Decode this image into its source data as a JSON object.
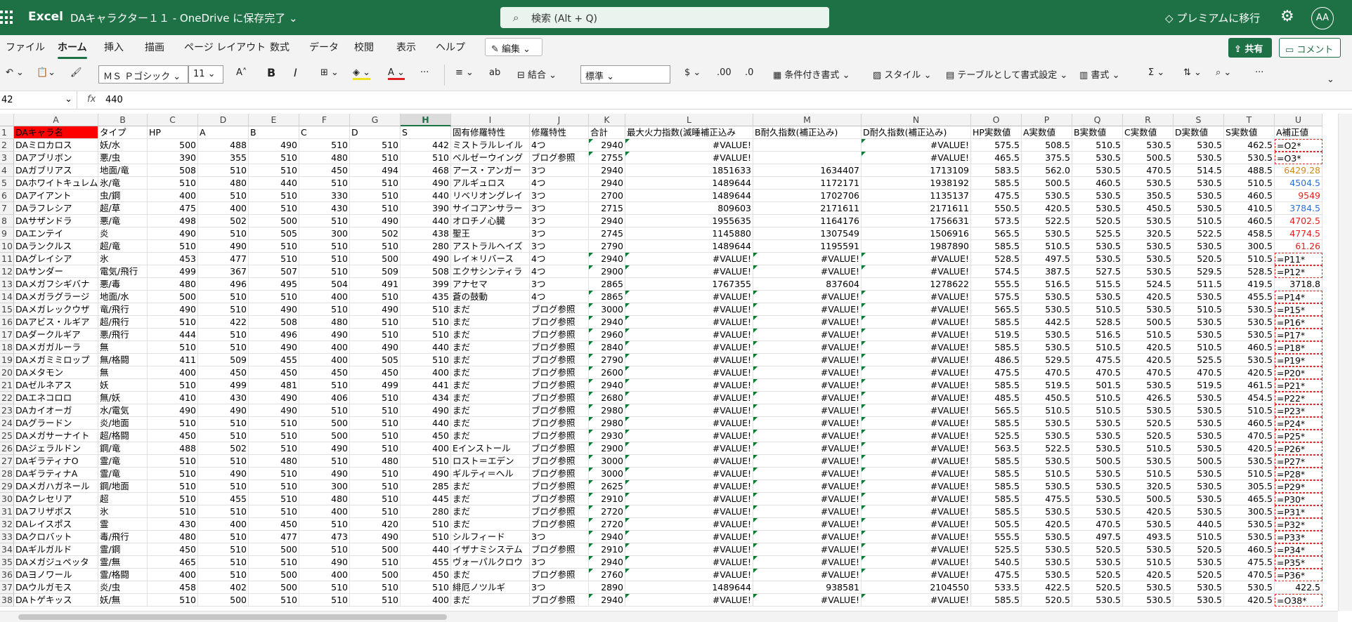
{
  "app": "Excel",
  "doc_title": "DAキャラクター１１ - OneDrive に保存完了 ⌄",
  "search_placeholder": "検索 (Alt + Q)",
  "premium": "プレミアムに移行",
  "avatar": "AA",
  "menu": [
    "ファイル",
    "ホーム",
    "挿入",
    "描画",
    "ページ レイアウト",
    "数式",
    "データ",
    "校閲",
    "表示",
    "ヘルプ"
  ],
  "edit_label": "✎ 編集 ⌄",
  "share_label": "共有",
  "comment_label": "コメント",
  "ribbon": {
    "font": "ＭＳ Ｐゴシック",
    "size": "11",
    "number_format": "標準",
    "merge": "結合",
    "cond_format": "条件付き書式",
    "style": "スタイル",
    "table_format": "テーブルとして書式設定",
    "format": "書式"
  },
  "namebox": "42",
  "formula": "440",
  "columns": [
    "A",
    "B",
    "C",
    "D",
    "E",
    "F",
    "G",
    "H",
    "I",
    "J",
    "K",
    "L",
    "M",
    "N",
    "O",
    "P",
    "Q",
    "R",
    "S",
    "T",
    "U"
  ],
  "selected_column": "H",
  "header_row": [
    "DAキャラ名",
    "タイプ",
    "HP",
    "A",
    "B",
    "C",
    "D",
    "S",
    "固有修羅特性",
    "修羅特性",
    "合計",
    "最大火力指数(滅睡補正込み",
    "B耐久指数(補正込み)",
    "D耐久指数(補正込み)",
    "HP実数値",
    "A実数値",
    "B実数値",
    "C実数値",
    "D実数値",
    "S実数値",
    "A補正値"
  ],
  "rows": [
    [
      "DAミロカロス",
      "妖/水",
      "500",
      "488",
      "490",
      "510",
      "510",
      "442",
      "ミストラルレイル",
      "4つ",
      "2940",
      "#VALUE!",
      "",
      "#VALUE!",
      "575.5",
      "508.5",
      "510.5",
      "530.5",
      "530.5",
      "462.5",
      "=O2*"
    ],
    [
      "DAアブリボン",
      "悪/虫",
      "390",
      "355",
      "510",
      "480",
      "510",
      "510",
      "ベルゼーウイング",
      "ブログ参照",
      "2755",
      "#VALUE!",
      "",
      "#VALUE!",
      "465.5",
      "375.5",
      "530.5",
      "500.5",
      "530.5",
      "530.5",
      "=O3*"
    ],
    [
      "DAガブリアス",
      "地面/竜",
      "508",
      "510",
      "510",
      "450",
      "494",
      "468",
      "アース・アンガー",
      "3つ",
      "2940",
      "1851633",
      "1634407",
      "1713109",
      "583.5",
      "562.0",
      "530.5",
      "470.5",
      "514.5",
      "488.5",
      "6429.28"
    ],
    [
      "DAホワイトキュレム",
      "氷/竜",
      "510",
      "480",
      "440",
      "510",
      "510",
      "490",
      "アルギュロス",
      "4つ",
      "2940",
      "1489644",
      "1172171",
      "1938192",
      "585.5",
      "500.5",
      "460.5",
      "530.5",
      "530.5",
      "510.5",
      "4504.5"
    ],
    [
      "DAアイアント",
      "虫/鋼",
      "400",
      "510",
      "510",
      "330",
      "510",
      "440",
      "リベリオングレイ",
      "3つ",
      "2700",
      "1489644",
      "1702706",
      "1135137",
      "475.5",
      "530.5",
      "530.5",
      "350.5",
      "530.5",
      "460.5",
      "9549"
    ],
    [
      "DAラフレシア",
      "超/草",
      "475",
      "400",
      "510",
      "430",
      "510",
      "390",
      "サイコアンサラー",
      "3つ",
      "2715",
      "809603",
      "2171611",
      "2171611",
      "550.5",
      "420.5",
      "530.5",
      "450.5",
      "530.5",
      "410.5",
      "3784.5"
    ],
    [
      "DAサザンドラ",
      "悪/竜",
      "498",
      "502",
      "500",
      "510",
      "490",
      "440",
      "オロチノ心臓",
      "3つ",
      "2940",
      "1955635",
      "1164176",
      "1756631",
      "573.5",
      "522.5",
      "520.5",
      "530.5",
      "510.5",
      "460.5",
      "4702.5"
    ],
    [
      "DAエンテイ",
      "炎",
      "490",
      "510",
      "505",
      "300",
      "502",
      "438",
      "聖王",
      "3つ",
      "2745",
      "1145880",
      "1307549",
      "1506916",
      "565.5",
      "530.5",
      "525.5",
      "320.5",
      "522.5",
      "458.5",
      "4774.5"
    ],
    [
      "DAランクルス",
      "超/竜",
      "510",
      "490",
      "510",
      "510",
      "510",
      "280",
      "アストラルヘイズ",
      "3つ",
      "2790",
      "1489644",
      "1195591",
      "1987890",
      "585.5",
      "510.5",
      "530.5",
      "530.5",
      "530.5",
      "300.5",
      "61.26"
    ],
    [
      "DAグレイシア",
      "氷",
      "453",
      "477",
      "510",
      "510",
      "500",
      "490",
      "レイ＊リバース",
      "4つ",
      "2940",
      "#VALUE!",
      "#VALUE!",
      "#VALUE!",
      "528.5",
      "497.5",
      "530.5",
      "530.5",
      "520.5",
      "510.5",
      "=P11*"
    ],
    [
      "DAサンダー",
      "電気/飛行",
      "499",
      "367",
      "507",
      "510",
      "509",
      "508",
      "エクサシンティラ",
      "4つ",
      "2900",
      "#VALUE!",
      "#VALUE!",
      "#VALUE!",
      "574.5",
      "387.5",
      "527.5",
      "530.5",
      "529.5",
      "528.5",
      "=P12*"
    ],
    [
      "DAメガフシギバナ",
      "悪/毒",
      "480",
      "496",
      "495",
      "504",
      "491",
      "399",
      "アナセマ",
      "3つ",
      "2865",
      "1767355",
      "837604",
      "1278622",
      "555.5",
      "516.5",
      "515.5",
      "524.5",
      "511.5",
      "419.5",
      "3718.8"
    ],
    [
      "DAメガラグラージ",
      "地面/水",
      "500",
      "510",
      "510",
      "400",
      "510",
      "435",
      "蒼の鼓動",
      "4つ",
      "2865",
      "#VALUE!",
      "#VALUE!",
      "#VALUE!",
      "575.5",
      "530.5",
      "530.5",
      "420.5",
      "530.5",
      "455.5",
      "=P14*"
    ],
    [
      "DAメガレックウザ",
      "竜/飛行",
      "490",
      "510",
      "490",
      "510",
      "490",
      "510",
      "まだ",
      "ブログ参照",
      "3000",
      "#VALUE!",
      "#VALUE!",
      "#VALUE!",
      "565.5",
      "530.5",
      "510.5",
      "530.5",
      "510.5",
      "530.5",
      "=P15*"
    ],
    [
      "DAアビス・ルギア",
      "超/飛行",
      "510",
      "422",
      "508",
      "480",
      "510",
      "510",
      "まだ",
      "ブログ参照",
      "2940",
      "#VALUE!",
      "#VALUE!",
      "#VALUE!",
      "585.5",
      "442.5",
      "528.5",
      "500.5",
      "530.5",
      "530.5",
      "=P16*"
    ],
    [
      "DAダークルギア",
      "悪/飛行",
      "444",
      "510",
      "496",
      "490",
      "510",
      "510",
      "まだ",
      "ブログ参照",
      "2960",
      "#VALUE!",
      "#VALUE!",
      "#VALUE!",
      "519.5",
      "530.5",
      "516.5",
      "510.5",
      "530.5",
      "530.5",
      "=P17*"
    ],
    [
      "DAメガガルーラ",
      "無",
      "510",
      "510",
      "490",
      "400",
      "490",
      "440",
      "まだ",
      "ブログ参照",
      "2840",
      "#VALUE!",
      "#VALUE!",
      "#VALUE!",
      "585.5",
      "530.5",
      "510.5",
      "420.5",
      "510.5",
      "460.5",
      "=P18*"
    ],
    [
      "DAメガミミロップ",
      "無/格闘",
      "411",
      "509",
      "455",
      "400",
      "505",
      "510",
      "まだ",
      "ブログ参照",
      "2790",
      "#VALUE!",
      "#VALUE!",
      "#VALUE!",
      "486.5",
      "529.5",
      "475.5",
      "420.5",
      "525.5",
      "530.5",
      "=P19*"
    ],
    [
      "DAメタモン",
      "無",
      "400",
      "450",
      "450",
      "450",
      "450",
      "400",
      "まだ",
      "ブログ参照",
      "2600",
      "#VALUE!",
      "#VALUE!",
      "#VALUE!",
      "475.5",
      "470.5",
      "470.5",
      "470.5",
      "470.5",
      "420.5",
      "=P20*"
    ],
    [
      "DAゼルネアス",
      "妖",
      "510",
      "499",
      "481",
      "510",
      "499",
      "441",
      "まだ",
      "ブログ参照",
      "2940",
      "#VALUE!",
      "#VALUE!",
      "#VALUE!",
      "585.5",
      "519.5",
      "501.5",
      "530.5",
      "519.5",
      "461.5",
      "=P21*"
    ],
    [
      "DAエネコロロ",
      "無/妖",
      "410",
      "430",
      "490",
      "406",
      "510",
      "434",
      "まだ",
      "ブログ参照",
      "2680",
      "#VALUE!",
      "#VALUE!",
      "#VALUE!",
      "485.5",
      "450.5",
      "510.5",
      "426.5",
      "530.5",
      "454.5",
      "=P22*"
    ],
    [
      "DAカイオーガ",
      "水/電気",
      "490",
      "490",
      "490",
      "510",
      "510",
      "490",
      "まだ",
      "ブログ参照",
      "2980",
      "#VALUE!",
      "#VALUE!",
      "#VALUE!",
      "565.5",
      "510.5",
      "510.5",
      "530.5",
      "530.5",
      "510.5",
      "=P23*"
    ],
    [
      "DAグラードン",
      "炎/地面",
      "510",
      "510",
      "510",
      "500",
      "510",
      "440",
      "まだ",
      "ブログ参照",
      "2980",
      "#VALUE!",
      "#VALUE!",
      "#VALUE!",
      "585.5",
      "530.5",
      "530.5",
      "520.5",
      "530.5",
      "460.5",
      "=P24*"
    ],
    [
      "DAメガサーナイト",
      "超/格闘",
      "450",
      "510",
      "510",
      "500",
      "510",
      "450",
      "まだ",
      "ブログ参照",
      "2930",
      "#VALUE!",
      "#VALUE!",
      "#VALUE!",
      "525.5",
      "530.5",
      "530.5",
      "520.5",
      "530.5",
      "470.5",
      "=P25*"
    ],
    [
      "DAジェラルドン",
      "鋼/竜",
      "488",
      "502",
      "510",
      "490",
      "510",
      "400",
      "Eインストール",
      "ブログ参照",
      "2900",
      "#VALUE!",
      "#VALUE!",
      "#VALUE!",
      "563.5",
      "522.5",
      "530.5",
      "510.5",
      "530.5",
      "420.5",
      "=P26*"
    ],
    [
      "DAギラティナO",
      "霊/竜",
      "510",
      "510",
      "480",
      "510",
      "480",
      "510",
      "ロスト＝エデン",
      "ブログ参照",
      "3000",
      "#VALUE!",
      "#VALUE!",
      "#VALUE!",
      "585.5",
      "530.5",
      "500.5",
      "530.5",
      "500.5",
      "530.5",
      "=P27*"
    ],
    [
      "DAギラティナA",
      "霊/竜",
      "510",
      "490",
      "510",
      "490",
      "510",
      "490",
      "ギルティ＝ヘル",
      "ブログ参照",
      "3000",
      "#VALUE!",
      "#VALUE!",
      "#VALUE!",
      "585.5",
      "510.5",
      "530.5",
      "510.5",
      "530.5",
      "510.5",
      "=P28*"
    ],
    [
      "DAメガハガネール",
      "鋼/地面",
      "510",
      "510",
      "510",
      "300",
      "510",
      "285",
      "まだ",
      "ブログ参照",
      "2625",
      "#VALUE!",
      "#VALUE!",
      "#VALUE!",
      "585.5",
      "530.5",
      "530.5",
      "320.5",
      "530.5",
      "305.5",
      "=P29*"
    ],
    [
      "DAクレセリア",
      "超",
      "510",
      "455",
      "510",
      "480",
      "510",
      "445",
      "まだ",
      "ブログ参照",
      "2910",
      "#VALUE!",
      "#VALUE!",
      "#VALUE!",
      "585.5",
      "475.5",
      "530.5",
      "500.5",
      "530.5",
      "465.5",
      "=P30*"
    ],
    [
      "DAフリザボス",
      "氷",
      "510",
      "510",
      "510",
      "400",
      "510",
      "280",
      "まだ",
      "ブログ参照",
      "2720",
      "#VALUE!",
      "#VALUE!",
      "#VALUE!",
      "585.5",
      "530.5",
      "530.5",
      "420.5",
      "530.5",
      "300.5",
      "=P31*"
    ],
    [
      "DAレイスポス",
      "霊",
      "430",
      "400",
      "450",
      "510",
      "420",
      "510",
      "まだ",
      "ブログ参照",
      "2720",
      "#VALUE!",
      "#VALUE!",
      "#VALUE!",
      "505.5",
      "420.5",
      "470.5",
      "530.5",
      "440.5",
      "530.5",
      "=P32*"
    ],
    [
      "DAクロバット",
      "毒/飛行",
      "480",
      "510",
      "477",
      "473",
      "490",
      "510",
      "シルフィード",
      "3つ",
      "2940",
      "#VALUE!",
      "#VALUE!",
      "#VALUE!",
      "555.5",
      "530.5",
      "497.5",
      "493.5",
      "510.5",
      "530.5",
      "=P33*"
    ],
    [
      "DAギルガルド",
      "霊/鋼",
      "450",
      "510",
      "500",
      "510",
      "500",
      "440",
      "イザナミシステム",
      "ブログ参照",
      "2910",
      "#VALUE!",
      "#VALUE!",
      "#VALUE!",
      "525.5",
      "530.5",
      "520.5",
      "530.5",
      "520.5",
      "460.5",
      "=P34*"
    ],
    [
      "DAメガジュペッタ",
      "霊/無",
      "465",
      "510",
      "510",
      "490",
      "510",
      "455",
      "ヴォーパルクロウ",
      "3つ",
      "2940",
      "#VALUE!",
      "#VALUE!",
      "#VALUE!",
      "540.5",
      "530.5",
      "530.5",
      "510.5",
      "530.5",
      "475.5",
      "=P35*"
    ],
    [
      "DAヨノワール",
      "霊/格闘",
      "400",
      "510",
      "500",
      "400",
      "500",
      "450",
      "まだ",
      "ブログ参照",
      "2760",
      "#VALUE!",
      "#VALUE!",
      "#VALUE!",
      "475.5",
      "530.5",
      "520.5",
      "420.5",
      "520.5",
      "470.5",
      "=P36*"
    ],
    [
      "DAウルガモス",
      "炎/虫",
      "458",
      "402",
      "500",
      "510",
      "510",
      "510",
      "緋厄ノツルギ",
      "3つ",
      "2890",
      "1489644",
      "938581",
      "2104550",
      "533.5",
      "422.5",
      "520.5",
      "530.5",
      "530.5",
      "530.5",
      "422.5"
    ],
    [
      "DAトゲキッス",
      "妖/無",
      "510",
      "500",
      "510",
      "510",
      "510",
      "400",
      "まだ",
      "ブログ参照",
      "2940",
      "#VALUE!",
      "#VALUE!",
      "#VALUE!",
      "585.5",
      "520.5",
      "530.5",
      "530.5",
      "530.5",
      "420.5",
      "=O38*"
    ]
  ],
  "u_colors": {
    "4": "#d08a1c",
    "5": "#2f6fd0",
    "6": "#e02020",
    "7": "#2f6fd0",
    "8": "#e02020",
    "9": "#e02020",
    "10": "#e02020"
  }
}
